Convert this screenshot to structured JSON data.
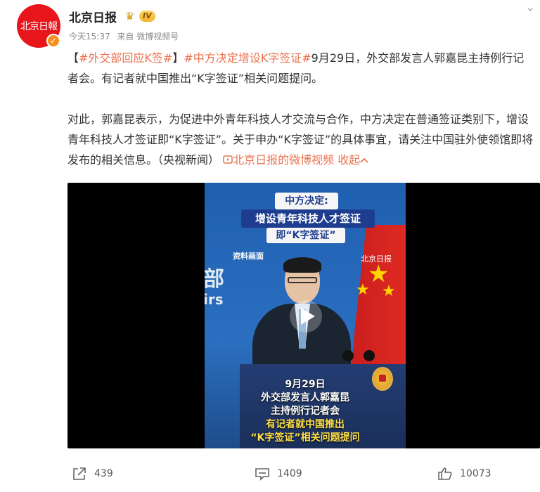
{
  "account": {
    "name": "北京日报",
    "avatar_text": "北京日報",
    "level_badge": "IV",
    "time": "今天15:37",
    "source": "来自 微博视频号"
  },
  "post": {
    "tag_open": "【",
    "tag1": "#外交部回应K签#",
    "tag_close": "】",
    "tag2": "#中方决定增设K字签证#",
    "line1_rest": "9月29日，外交部发言人郭嘉昆主持例行记者会。有记者就中国推出“K字签证”相关问题提问。",
    "para2": "对此，郭嘉昆表示，为促进中外青年科技人才交流与合作，中方决定在普通签证类别下，增设青年科技人才签证即“K字签证”。关于申办“K字签证”的具体事宜，请关注中国驻外使领馆即将发布的相关信息。（央视新闻）",
    "video_link": "北京日报的微博视频",
    "collapse": "收起"
  },
  "video": {
    "caption_1": "中方决定:",
    "caption_2": "增设青年科技人才签证",
    "caption_3": "即“K字签证”",
    "archive_label": "资料画面",
    "flag_watermark": "北京日报",
    "wall_text_1": "部",
    "wall_text_2": "irs",
    "bottom_1": "9月29日",
    "bottom_2": "外交部发言人郭嘉昆",
    "bottom_3": "主持例行记者会",
    "bottom_4": "有记者就中国推出",
    "bottom_5": "“K字签证”相关问题提问"
  },
  "actions": {
    "share_count": "439",
    "comment_count": "1409",
    "like_count": "10073"
  },
  "colors": {
    "tag": "#eb7350",
    "brand_red": "#e8151b",
    "caption_blue": "#1e3d8f",
    "caption_yellow": "#ffe04a"
  },
  "icons": [
    "share-icon",
    "comment-icon",
    "like-icon",
    "play-icon",
    "more-icon",
    "video-link-icon",
    "chevron-up-icon",
    "crown-icon"
  ]
}
